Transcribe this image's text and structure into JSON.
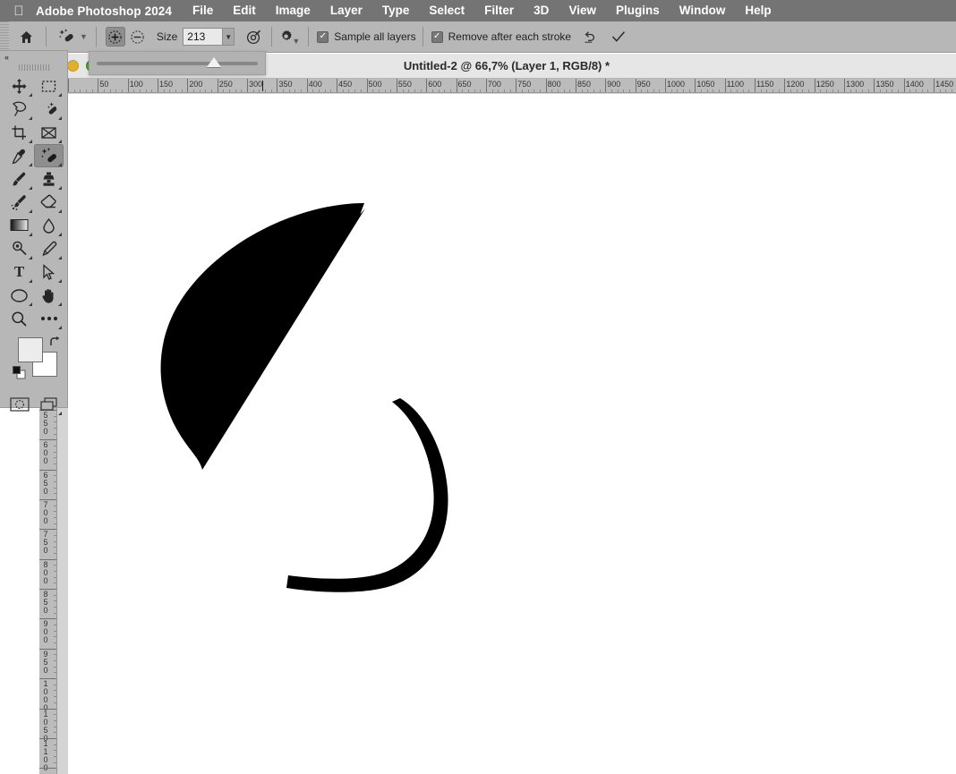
{
  "menubar": {
    "apple_icon": "apple-logo",
    "app_name": "Adobe Photoshop 2024",
    "items": [
      {
        "label": "File"
      },
      {
        "label": "Edit"
      },
      {
        "label": "Image"
      },
      {
        "label": "Layer"
      },
      {
        "label": "Type"
      },
      {
        "label": "Select"
      },
      {
        "label": "Filter"
      },
      {
        "label": "3D"
      },
      {
        "label": "View"
      },
      {
        "label": "Plugins"
      },
      {
        "label": "Window"
      },
      {
        "label": "Help"
      }
    ]
  },
  "options_bar": {
    "home_icon": "home-icon",
    "tool_preset_icon": "spot-healing-brush-icon",
    "preset_chevron_icon": "chevron-down-icon",
    "add_mode_icon": "circle-plus-icon",
    "subtract_mode_icon": "circle-minus-icon",
    "size_label": "Size",
    "size_value": "213",
    "size_dropdown_icon": "chevron-down-icon",
    "pressure_icon": "tablet-pressure-icon",
    "gear_icon": "gear-icon",
    "sample_all_layers_label": "Sample all layers",
    "sample_all_layers_checked": "✓",
    "remove_after_stroke_label": "Remove after each stroke",
    "remove_after_stroke_checked": "✓",
    "reset_icon": "undo-arrow-icon",
    "confirm_icon": "checkmark-icon"
  },
  "size_slider_popup": {
    "name": "brush-size-slider",
    "value_percent": 73
  },
  "document": {
    "title": "Untitled-2 @ 66,7% (Layer 1, RGB/8) *",
    "zoom": "66,7%",
    "layer": "Layer 1",
    "color_mode": "RGB/8",
    "modified": "*",
    "window_controls": {
      "minimize": "minimize-button",
      "zoom": "zoom-button"
    }
  },
  "rulers": {
    "unit": "px",
    "horizontal_labels": [
      50,
      100,
      150,
      200,
      250,
      300,
      350,
      400,
      450,
      500,
      550,
      600,
      650,
      700,
      750,
      800,
      850,
      900,
      950,
      1000,
      1050,
      1100,
      1150,
      1200,
      1250,
      1300,
      1350,
      1400,
      1450
    ],
    "horizontal_start": 50,
    "horizontal_step": 50,
    "vertical_labels": [
      550,
      600,
      650,
      700,
      750,
      800,
      850,
      900,
      950,
      1000,
      1050,
      1100
    ],
    "vertical_start": 550,
    "vertical_step": 50,
    "cursor_x_marker": 325
  },
  "tools": {
    "collapse_icon": "double-chevron-left-icon",
    "items": [
      {
        "name": "move-tool",
        "icon": "move-icon"
      },
      {
        "name": "rectangular-marquee-tool",
        "icon": "marquee-rectangle-icon"
      },
      {
        "name": "lasso-tool",
        "icon": "lasso-icon"
      },
      {
        "name": "object-selection-tool",
        "icon": "magic-wand-icon"
      },
      {
        "name": "crop-tool",
        "icon": "crop-icon"
      },
      {
        "name": "frame-tool",
        "icon": "frame-icon"
      },
      {
        "name": "eyedropper-tool",
        "icon": "eyedropper-icon"
      },
      {
        "name": "spot-healing-brush-tool",
        "icon": "spot-healing-brush-icon",
        "selected": true
      },
      {
        "name": "brush-tool",
        "icon": "paintbrush-icon"
      },
      {
        "name": "clone-stamp-tool",
        "icon": "clone-stamp-icon"
      },
      {
        "name": "history-brush-tool",
        "icon": "history-brush-icon"
      },
      {
        "name": "eraser-tool",
        "icon": "eraser-icon"
      },
      {
        "name": "gradient-tool",
        "icon": "gradient-icon"
      },
      {
        "name": "blur-tool",
        "icon": "waterdrop-icon"
      },
      {
        "name": "dodge-tool",
        "icon": "dodge-icon"
      },
      {
        "name": "pen-tool",
        "icon": "pen-icon"
      },
      {
        "name": "type-tool",
        "icon": "text-T-icon"
      },
      {
        "name": "path-selection-tool",
        "icon": "arrow-cursor-icon"
      },
      {
        "name": "ellipse-tool",
        "icon": "ellipse-icon"
      },
      {
        "name": "hand-tool",
        "icon": "hand-icon"
      },
      {
        "name": "zoom-tool",
        "icon": "magnifier-icon"
      },
      {
        "name": "edit-toolbar",
        "icon": "ellipsis-icon"
      }
    ],
    "foreground_color": "#ececec",
    "background_color": "#ffffff",
    "swap_icon": "swap-colors-icon",
    "default_colors_icon": "default-colors-icon",
    "quick_mask_icon": "quick-mask-icon",
    "screen_mode_icon": "screen-mode-icon"
  },
  "artwork": {
    "description": "Two hand-drawn black petal outlines on white canvas",
    "stroke_color": "#000000",
    "shapes": [
      {
        "name": "petal-shape-upper"
      },
      {
        "name": "petal-shape-lower"
      }
    ]
  },
  "colors": {
    "menubar_bg": "#747474",
    "options_bg": "#b7b7b7",
    "panel_bg": "#b7b7b7",
    "canvas_bg": "#ffffff",
    "ruler_bg": "#bcbcbc",
    "titlebar_bg": "#e6e6e6"
  }
}
